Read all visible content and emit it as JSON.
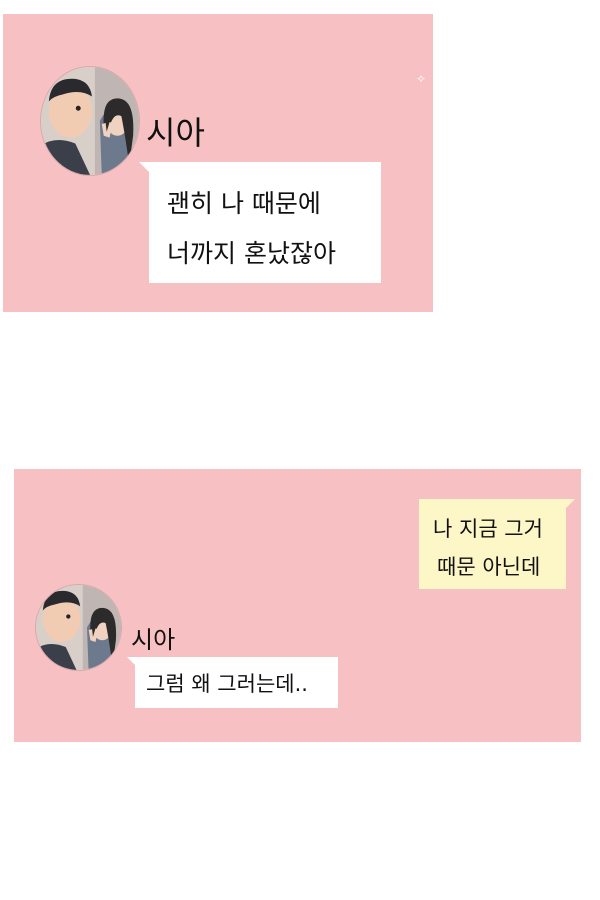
{
  "panels": [
    {
      "contact_name": "시아",
      "messages": [
        {
          "from": "contact",
          "lines": [
            "괜히 나 때문에",
            "너까지 혼났잖아"
          ]
        }
      ]
    },
    {
      "contact_name": "시아",
      "messages": [
        {
          "from": "me",
          "lines": [
            "나 지금 그거",
            "때문 아닌데"
          ]
        },
        {
          "from": "contact",
          "lines": [
            "그럼 왜 그러는데.."
          ]
        }
      ]
    }
  ],
  "colors": {
    "panel_background": "#f7c1c3",
    "contact_bubble": "#ffffff",
    "my_bubble": "#fdf6c7"
  },
  "icons": {
    "avatar": "avatar-photo-icon"
  }
}
